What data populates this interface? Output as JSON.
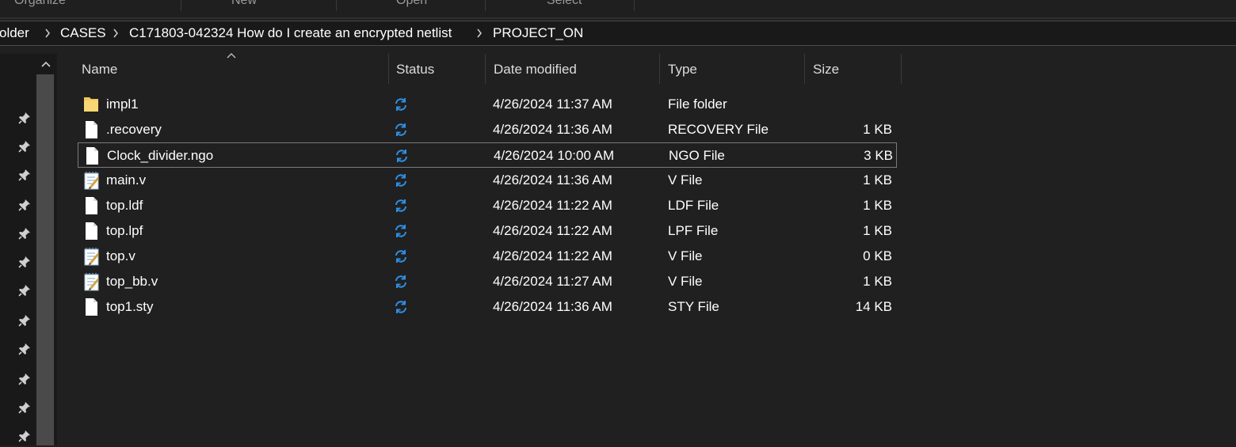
{
  "ribbon": {
    "groups": [
      "Organize",
      "New",
      "Open",
      "Select"
    ]
  },
  "breadcrumb": [
    "older",
    "CASES",
    "C171803-042324 How do I create an encrypted netlist",
    "PROJECT_ON"
  ],
  "columns": {
    "name": "Name",
    "status": "Status",
    "date": "Date modified",
    "type": "Type",
    "size": "Size"
  },
  "files": [
    {
      "name": "impl1",
      "icon": "folder-icon",
      "date": "4/26/2024 11:37 AM",
      "type": "File folder",
      "size": ""
    },
    {
      "name": ".recovery",
      "icon": "file-icon",
      "date": "4/26/2024 11:36 AM",
      "type": "RECOVERY File",
      "size": "1 KB"
    },
    {
      "name": "Clock_divider.ngo",
      "icon": "file-icon",
      "date": "4/26/2024 10:00 AM",
      "type": "NGO File",
      "size": "3 KB"
    },
    {
      "name": "main.v",
      "icon": "notepad-file-icon",
      "date": "4/26/2024 11:36 AM",
      "type": "V File",
      "size": "1 KB"
    },
    {
      "name": "top.ldf",
      "icon": "file-icon",
      "date": "4/26/2024 11:22 AM",
      "type": "LDF File",
      "size": "1 KB"
    },
    {
      "name": "top.lpf",
      "icon": "file-icon",
      "date": "4/26/2024 11:22 AM",
      "type": "LPF File",
      "size": "1 KB"
    },
    {
      "name": "top.v",
      "icon": "notepad-file-icon",
      "date": "4/26/2024 11:22 AM",
      "type": "V File",
      "size": "0 KB"
    },
    {
      "name": "top_bb.v",
      "icon": "notepad-file-icon",
      "date": "4/26/2024 11:27 AM",
      "type": "V File",
      "size": "1 KB"
    },
    {
      "name": "top1.sty",
      "icon": "file-icon",
      "date": "4/26/2024 11:36 AM",
      "type": "STY File",
      "size": "14 KB"
    }
  ],
  "status_icon": "sync-icon",
  "colors": {
    "background": "#202020",
    "sync_blue": "#2f8fe6",
    "folder_yellow": "#f7d774"
  }
}
